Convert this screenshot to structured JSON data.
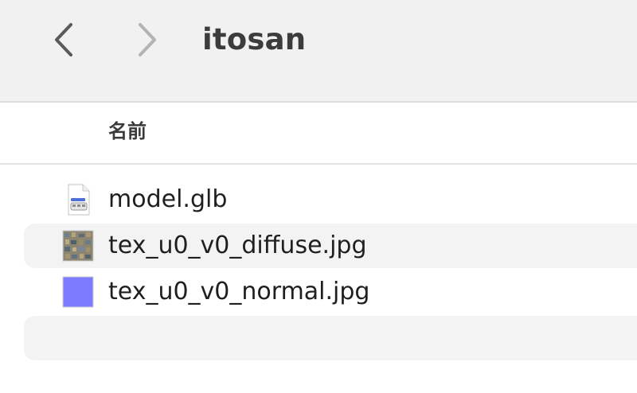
{
  "window": {
    "title": "itosan"
  },
  "toolbar": {
    "back_icon": "chevron-left-icon",
    "forward_icon": "chevron-right-icon"
  },
  "columns": {
    "name_label": "名前"
  },
  "files": [
    {
      "name": "model.glb",
      "icon": "document-icon",
      "highlighted": false
    },
    {
      "name": "tex_u0_v0_diffuse.jpg",
      "icon": "image-thumbnail-icon",
      "highlighted": true
    },
    {
      "name": "tex_u0_v0_normal.jpg",
      "icon": "image-thumbnail-icon",
      "highlighted": false
    }
  ],
  "colors": {
    "toolbar_bg": "#f1f1f1",
    "row_alt_bg": "#f3f3f3",
    "normal_map_color": "#7b7bff"
  }
}
